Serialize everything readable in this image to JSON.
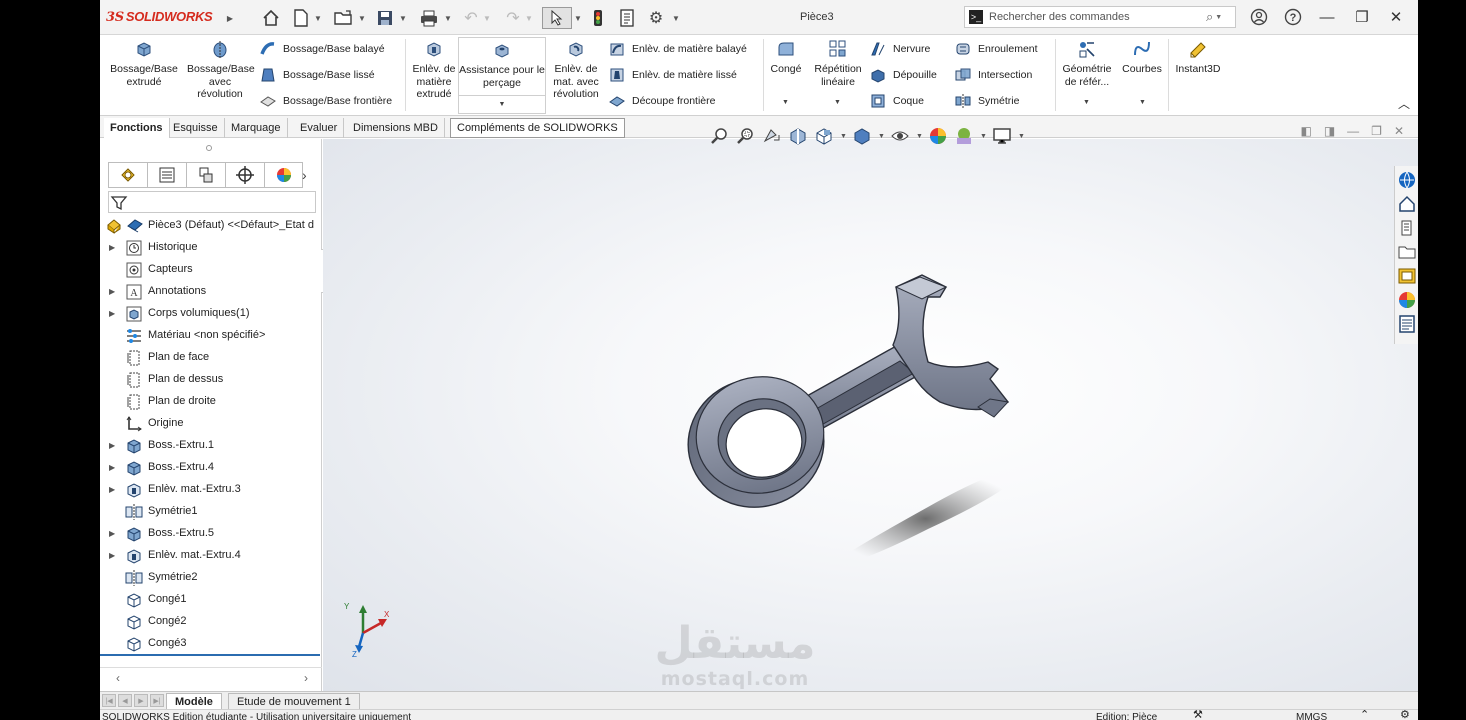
{
  "titlebar": {
    "logo_ds": "3S",
    "logo_text": "SOLIDWORKS",
    "document_title": "Pièce3",
    "search_placeholder": "Rechercher des commandes"
  },
  "ribbon": {
    "extrude_boss": "Bossage/Base extrudé",
    "revolve_boss": "Bossage/Base avec révolution",
    "swept_boss": "Bossage/Base balayé",
    "loft_boss": "Bossage/Base lissé",
    "boundary_boss": "Bossage/Base frontière",
    "extrude_cut": "Enlèv. de matière extrudé",
    "hole_wizard": "Assistance pour le perçage",
    "revolve_cut": "Enlèv. de mat. avec révolution",
    "swept_cut": "Enlèv. de matière balayé",
    "loft_cut": "Enlèv. de matière lissé",
    "boundary_cut": "Découpe frontière",
    "fillet": "Congé",
    "linear_pattern": "Répétition linéaire",
    "rib": "Nervure",
    "draft": "Dépouille",
    "shell": "Coque",
    "wrap": "Enroulement",
    "intersect": "Intersection",
    "mirror": "Symétrie",
    "ref_geometry": "Géométrie de référ...",
    "curves": "Courbes",
    "instant3d": "Instant3D"
  },
  "tabs": [
    "Fonctions",
    "Esquisse",
    "Marquage",
    "Evaluer",
    "Dimensions MBD",
    "Compléments de SOLIDWORKS"
  ],
  "tree": {
    "root": "Pièce3  (Défaut) <<Défaut>_Etat d",
    "items": [
      {
        "label": "Historique",
        "icon": "history-icon",
        "arrow": true
      },
      {
        "label": "Capteurs",
        "icon": "sensor-icon",
        "arrow": false
      },
      {
        "label": "Annotations",
        "icon": "annotation-icon",
        "arrow": true
      },
      {
        "label": "Corps volumiques(1)",
        "icon": "solid-bodies-icon",
        "arrow": true
      },
      {
        "label": "Matériau <non spécifié>",
        "icon": "material-icon",
        "arrow": false
      },
      {
        "label": "Plan de face",
        "icon": "plane-icon",
        "arrow": false
      },
      {
        "label": "Plan de dessus",
        "icon": "plane-icon",
        "arrow": false
      },
      {
        "label": "Plan de droite",
        "icon": "plane-icon",
        "arrow": false
      },
      {
        "label": "Origine",
        "icon": "origin-icon",
        "arrow": false
      },
      {
        "label": "Boss.-Extru.1",
        "icon": "boss-extrude-icon",
        "arrow": true
      },
      {
        "label": "Boss.-Extru.4",
        "icon": "boss-extrude-icon",
        "arrow": true
      },
      {
        "label": "Enlèv. mat.-Extru.3",
        "icon": "cut-extrude-icon",
        "arrow": true
      },
      {
        "label": "Symétrie1",
        "icon": "mirror-icon",
        "arrow": false
      },
      {
        "label": "Boss.-Extru.5",
        "icon": "boss-extrude-icon",
        "arrow": true
      },
      {
        "label": "Enlèv. mat.-Extru.4",
        "icon": "cut-extrude-icon",
        "arrow": true
      },
      {
        "label": "Symétrie2",
        "icon": "mirror-icon",
        "arrow": false
      },
      {
        "label": "Congé1",
        "icon": "fillet-icon",
        "arrow": false
      },
      {
        "label": "Congé2",
        "icon": "fillet-icon",
        "arrow": false
      },
      {
        "label": "Congé3",
        "icon": "fillet-icon",
        "arrow": false
      }
    ]
  },
  "triad": {
    "x": "X",
    "y": "Y",
    "z": "Z"
  },
  "bottom_tabs": [
    "Modèle",
    "Etude de mouvement 1"
  ],
  "status": {
    "left": "SOLIDWORKS Edition étudiante - Utilisation universitaire uniquement",
    "mode": "Edition: Pièce",
    "units": "MMGS"
  },
  "watermark": {
    "arabic": "مستقل",
    "latin": "mostaql.com"
  },
  "colors": {
    "accent": "#d52b1e",
    "model": "#8d94a6",
    "selection_blue": "#2b6cb0"
  }
}
